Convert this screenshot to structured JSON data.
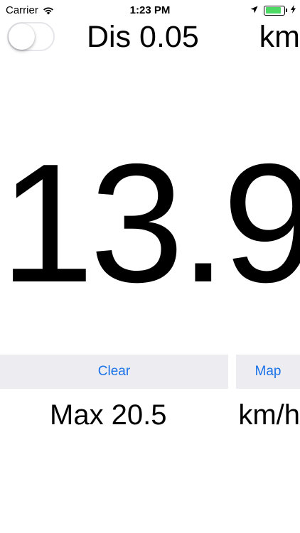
{
  "status_bar": {
    "carrier": "Carrier",
    "time": "1:23 PM",
    "wifi_icon": "wifi-icon",
    "location_icon": "location-arrow-icon",
    "battery_icon": "battery-icon",
    "charging_icon": "charging-bolt-icon",
    "battery_color": "#4cd964",
    "battery_level": 0.85
  },
  "top_row": {
    "toggle_state": "off",
    "distance_label": "Dis 0.05",
    "distance_unit": "km"
  },
  "speed": {
    "value": "13.9"
  },
  "buttons": {
    "clear_label": "Clear",
    "map_label": "Map",
    "accent_color": "#1a73e8"
  },
  "bottom_row": {
    "max_label": "Max 20.5",
    "speed_unit": "km/h"
  }
}
